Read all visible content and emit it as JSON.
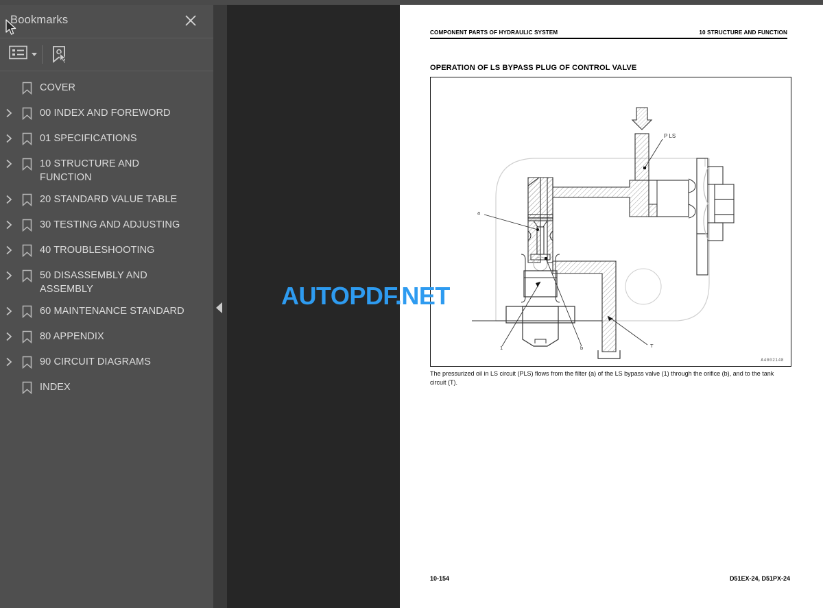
{
  "sidebar": {
    "title": "Bookmarks",
    "close_icon": "close-icon",
    "toolbar": {
      "list_options_icon": "list-options-icon",
      "list_options_caret_icon": "chevron-down-icon",
      "new_bookmark_icon": "new-bookmark-icon"
    },
    "items": [
      {
        "label": "COVER",
        "expandable": false
      },
      {
        "label": "00 INDEX AND FOREWORD",
        "expandable": true
      },
      {
        "label": "01 SPECIFICATIONS",
        "expandable": true
      },
      {
        "label": "10 STRUCTURE AND FUNCTION",
        "expandable": true
      },
      {
        "label": "20 STANDARD VALUE TABLE",
        "expandable": true
      },
      {
        "label": "30 TESTING AND ADJUSTING",
        "expandable": true
      },
      {
        "label": "40 TROUBLESHOOTING",
        "expandable": true
      },
      {
        "label": "50 DISASSEMBLY AND ASSEMBLY",
        "expandable": true
      },
      {
        "label": "60 MAINTENANCE STANDARD",
        "expandable": true
      },
      {
        "label": "80 APPENDIX",
        "expandable": true
      },
      {
        "label": "90 CIRCUIT DIAGRAMS",
        "expandable": true
      },
      {
        "label": "INDEX",
        "expandable": false
      }
    ]
  },
  "splitter": {
    "collapse_handle_icon": "chevron-left-icon"
  },
  "document": {
    "header_left": "COMPONENT PARTS OF HYDRAULIC SYSTEM",
    "header_right": "10 STRUCTURE AND FUNCTION",
    "section_title": "OPERATION OF LS BYPASS PLUG OF CONTROL VALVE",
    "figure": {
      "code": "A4002148",
      "labels": {
        "pls": "P LS",
        "a": "a",
        "one": "1",
        "b": "b",
        "t": "T"
      }
    },
    "caption": "The pressurized oil in LS circuit (PLS) flows from the filter (a) of the LS bypass valve (1) through the orifice (b), and to the tank circuit (T).",
    "footer_left": "10-154",
    "footer_right": "D51EX-24, D51PX-24"
  },
  "watermark": {
    "text": "AUTOPDF.NET",
    "color": "#2e9bf0"
  },
  "colors": {
    "sidebar_bg": "#4f4f4f",
    "splitter_bg": "#3a3a3a",
    "backdrop_bg": "#262626",
    "page_bg": "#ffffff",
    "text": "#dcdcdc"
  }
}
